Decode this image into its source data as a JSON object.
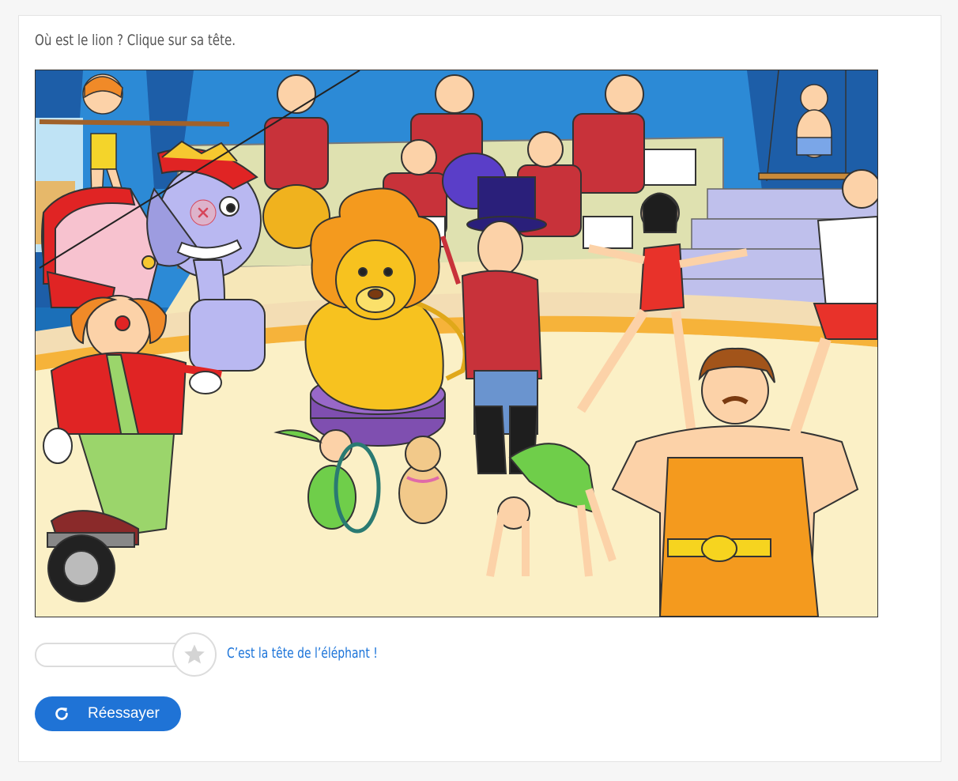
{
  "question": "Où est le lion ? Clique sur sa tête.",
  "scene": {
    "description_icon": "circus-scene",
    "marker_icon": "close-icon"
  },
  "progress": {
    "value": 0,
    "star_icon": "star-icon"
  },
  "feedback": "C’est la tête de l’éléphant !",
  "retry": {
    "label": "Réessayer",
    "icon": "refresh-icon"
  },
  "colors": {
    "accent": "#1f73d6",
    "feedback": "#1a73d9",
    "marker": "#d6465a"
  }
}
